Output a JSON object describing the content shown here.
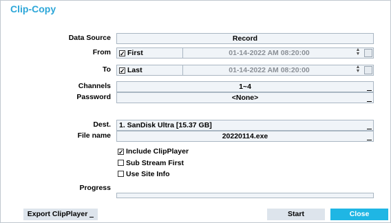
{
  "dialog": {
    "title": "Clip-Copy"
  },
  "labels": {
    "data_source": "Data Source",
    "from": "From",
    "to": "To",
    "channels": "Channels",
    "password": "Password",
    "dest": "Dest.",
    "file_name": "File name",
    "progress": "Progress"
  },
  "fields": {
    "data_source": "Record",
    "from_check": "First",
    "from_datetime": "01-14-2022  AM 08:20:00",
    "to_check": "Last",
    "to_datetime": "01-14-2022  AM 08:20:00",
    "channels": "1~4",
    "password": "<None>",
    "dest": "1. SanDisk Ultra [15.37 GB]",
    "file_name": "20220114.exe"
  },
  "options": {
    "include_clipplayer": "Include ClipPlayer",
    "include_clipplayer_checked": true,
    "sub_stream_first": "Sub Stream First",
    "sub_stream_first_checked": false,
    "use_site_info": "Use Site Info",
    "use_site_info_checked": false
  },
  "buttons": {
    "export_clipplayer": "Export ClipPlayer",
    "start": "Start",
    "close": "Close"
  },
  "icons": {
    "check": "✓"
  },
  "colors": {
    "accent": "#2ca6d8",
    "close_button": "#1fb6e4",
    "field_bg": "#f0f4f8"
  }
}
